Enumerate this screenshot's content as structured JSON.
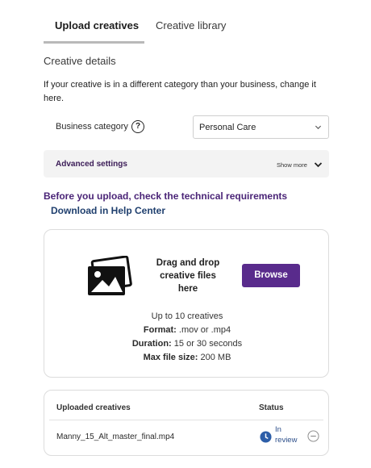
{
  "tabs": [
    {
      "label": "Upload creatives",
      "active": true
    },
    {
      "label": "Creative library",
      "active": false
    }
  ],
  "creative_details": {
    "title": "Creative details",
    "helper": "If your creative is in a different category than your business, change it here.",
    "business_category_label": "Business category",
    "help_icon_glyph": "?",
    "business_category_value": "Personal Care"
  },
  "advanced": {
    "label": "Advanced settings",
    "toggle": "Show more"
  },
  "requirements": {
    "heading": "Before you upload, check the technical requirements",
    "link": "Download in Help Center"
  },
  "dropzone": {
    "drag_text": "Drag and drop creative files here",
    "browse_label": "Browse",
    "limit_text": "Up to 10 creatives",
    "format_label": "Format:",
    "format_value": ".mov or .mp4",
    "duration_label": "Duration:",
    "duration_value": "15 or 30 seconds",
    "max_size_label": "Max file size:",
    "max_size_value": "200 MB"
  },
  "uploaded": {
    "header": "Uploaded creatives",
    "status_header": "Status",
    "rows": [
      {
        "file": "Manny_15_Alt_master_final.mp4",
        "status": "In review"
      }
    ]
  },
  "colors": {
    "accent_purple": "#592b8c",
    "heading_purple": "#4a2477",
    "link_navy": "#1f3f6e",
    "status_blue": "#2d5ea8"
  },
  "icons": [
    "help-circle-icon",
    "chevron-down-icon",
    "photo-stack-icon",
    "clock-icon",
    "remove-circle-icon"
  ]
}
